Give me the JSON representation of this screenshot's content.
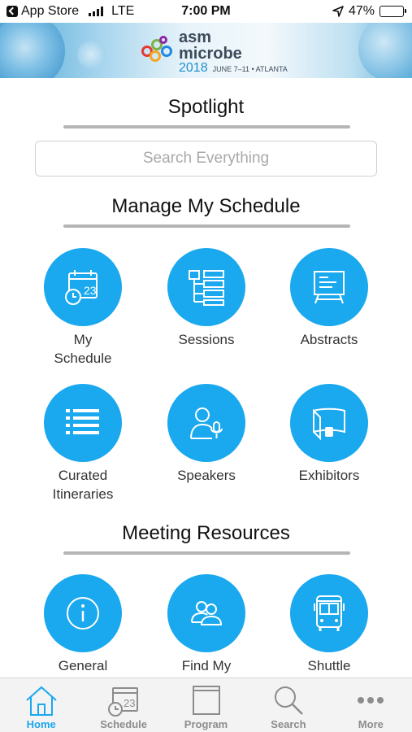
{
  "status_bar": {
    "back_app": "App Store",
    "network": "LTE",
    "time": "7:00 PM",
    "battery": "47%",
    "battery_level": 0.47
  },
  "banner": {
    "logo_line1": "asm",
    "logo_line2": "microbe",
    "logo_year": "2018",
    "logo_dates": "JUNE 7–11 • ATLANTA"
  },
  "spotlight": {
    "title": "Spotlight",
    "search_placeholder": "Search Everything"
  },
  "schedule": {
    "title": "Manage My Schedule",
    "tiles": [
      {
        "label_line1": "My",
        "label_line2": "Schedule",
        "icon": "calendar-icon"
      },
      {
        "label_line1": "Sessions",
        "label_line2": "",
        "icon": "sessions-list-icon"
      },
      {
        "label_line1": "Abstracts",
        "label_line2": "",
        "icon": "presentation-board-icon"
      },
      {
        "label_line1": "Curated",
        "label_line2": "Itineraries",
        "icon": "list-icon"
      },
      {
        "label_line1": "Speakers",
        "label_line2": "",
        "icon": "speaker-icon"
      },
      {
        "label_line1": "Exhibitors",
        "label_line2": "",
        "icon": "exhibitor-booth-icon"
      }
    ]
  },
  "resources": {
    "title": "Meeting Resources",
    "tiles": [
      {
        "label_line1": "General",
        "icon": "info-icon"
      },
      {
        "label_line1": "Find My",
        "icon": "people-icon"
      },
      {
        "label_line1": "Shuttle",
        "icon": "bus-icon"
      }
    ]
  },
  "calendar_day": "23",
  "tab_bar": {
    "tabs": [
      {
        "label": "Home",
        "icon": "home-icon",
        "active": true
      },
      {
        "label": "Schedule",
        "icon": "calendar-icon",
        "active": false
      },
      {
        "label": "Program",
        "icon": "book-icon",
        "active": false
      },
      {
        "label": "Search",
        "icon": "search-icon",
        "active": false
      },
      {
        "label": "More",
        "icon": "more-icon",
        "active": false
      }
    ]
  },
  "colors": {
    "accent": "#1aa8ee",
    "tab_inactive": "#8c8c8c",
    "rule": "#b5b5b5"
  }
}
